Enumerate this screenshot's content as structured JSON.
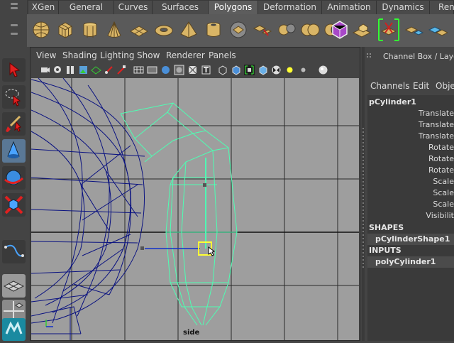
{
  "shelf": {
    "tabs": [
      "XGen",
      "General",
      "Curves",
      "Surfaces",
      "Polygons",
      "Deformation",
      "Animation",
      "Dynamics",
      "Ren"
    ],
    "active_tab": "Polygons"
  },
  "panel": {
    "menus": [
      "View",
      "Shading",
      "Lighting",
      "Show",
      "Renderer",
      "Panels"
    ],
    "camera": "side"
  },
  "channel_box": {
    "title": "Channel Box / Layer E",
    "menus": [
      "Channels",
      "Edit",
      "Objec"
    ],
    "object": "pCylinder1",
    "attributes": [
      "Translate",
      "Translate",
      "Translate",
      "Rotate",
      "Rotate",
      "Rotate",
      "Scale",
      "Scale",
      "Scale",
      "Visibilit"
    ],
    "shapes_label": "SHAPES",
    "shape": "pCylinderShape1",
    "inputs_label": "INPUTS",
    "input": "polyCylinder1"
  },
  "colors": {
    "viewport_bg": "#9e9e9e",
    "wire_selected": "#4dffb3",
    "wire_unselected": "#0a1280",
    "manipulator": "#ffff33"
  }
}
